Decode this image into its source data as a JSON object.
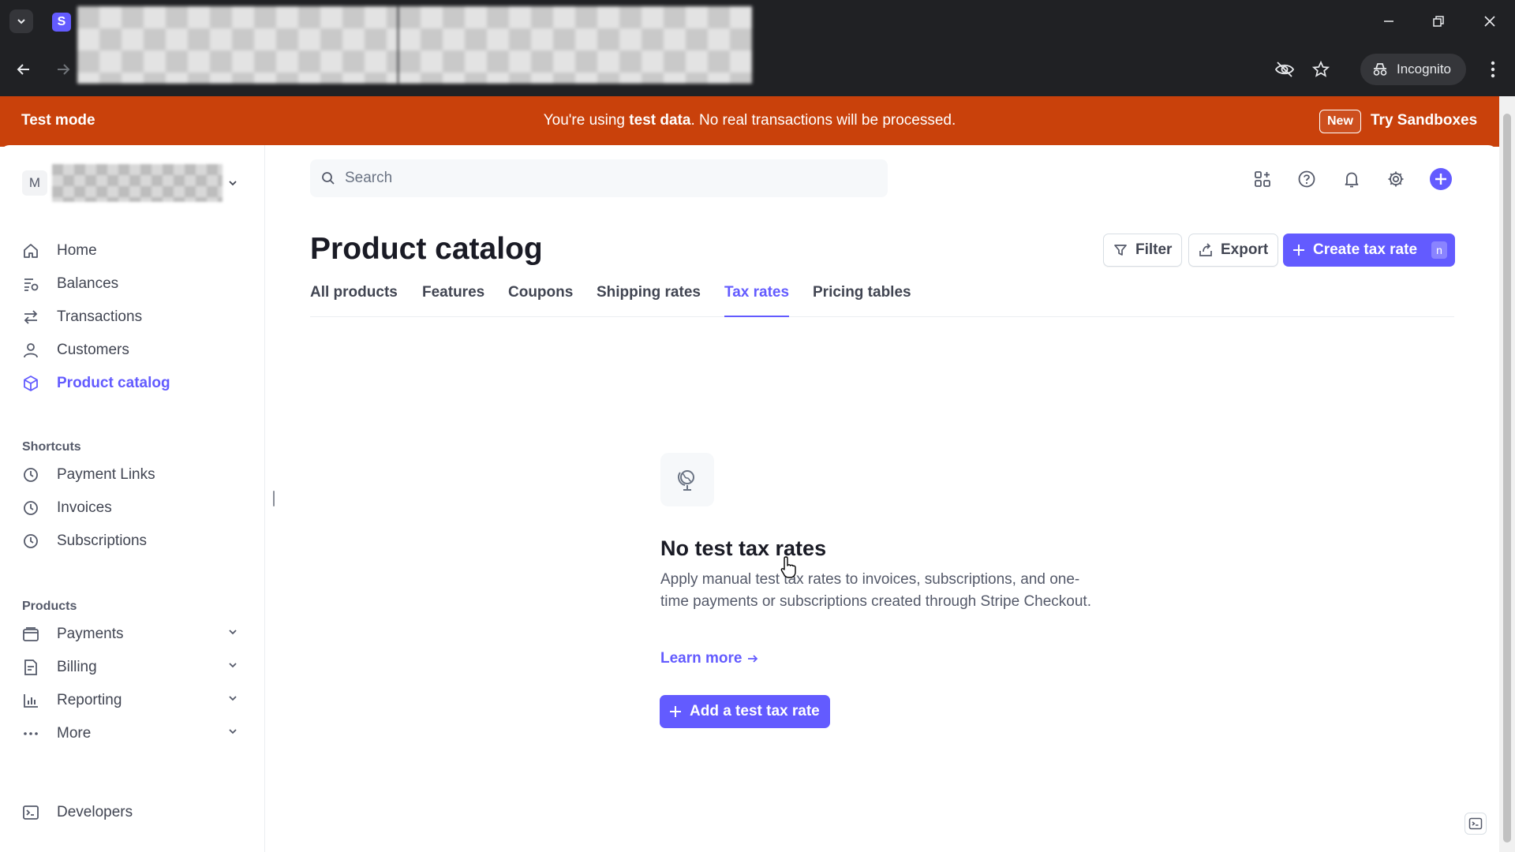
{
  "browser": {
    "favicon_letter": "S",
    "incognito_label": "Incognito"
  },
  "banner": {
    "mode_label": "Test mode",
    "message_prefix": "You're using ",
    "message_bold": "test data",
    "message_suffix": ". No real transactions will be processed.",
    "new_badge": "New",
    "sandbox_link": "Try Sandboxes",
    "color": "#c9410b"
  },
  "account": {
    "initial": "M"
  },
  "sidebar": {
    "items": [
      {
        "label": "Home",
        "icon": "home-icon"
      },
      {
        "label": "Balances",
        "icon": "balances-icon"
      },
      {
        "label": "Transactions",
        "icon": "transactions-icon"
      },
      {
        "label": "Customers",
        "icon": "customers-icon"
      },
      {
        "label": "Product catalog",
        "icon": "product-catalog-icon",
        "active": true
      }
    ],
    "shortcuts_title": "Shortcuts",
    "shortcuts": [
      {
        "label": "Payment Links",
        "icon": "clock-icon"
      },
      {
        "label": "Invoices",
        "icon": "clock-icon"
      },
      {
        "label": "Subscriptions",
        "icon": "clock-icon"
      }
    ],
    "products_title": "Products",
    "products": [
      {
        "label": "Payments",
        "icon": "payments-icon"
      },
      {
        "label": "Billing",
        "icon": "billing-icon"
      },
      {
        "label": "Reporting",
        "icon": "reporting-icon"
      },
      {
        "label": "More",
        "icon": "more-icon"
      }
    ],
    "developers": {
      "label": "Developers",
      "icon": "terminal-icon"
    }
  },
  "search": {
    "placeholder": "Search"
  },
  "header": {
    "title": "Product catalog",
    "filter_label": "Filter",
    "export_label": "Export",
    "create_label": "Create tax rate",
    "create_shortcut": "n"
  },
  "tabs": [
    {
      "label": "All products"
    },
    {
      "label": "Features"
    },
    {
      "label": "Coupons"
    },
    {
      "label": "Shipping rates"
    },
    {
      "label": "Tax rates",
      "active": true
    },
    {
      "label": "Pricing tables"
    }
  ],
  "empty_state": {
    "icon": "globe-icon",
    "title": "No test tax rates",
    "description": "Apply manual test tax rates to invoices, subscriptions, and one-time payments or subscriptions created through Stripe Checkout.",
    "learn_more": "Learn more",
    "add_button": "Add a test tax rate"
  },
  "colors": {
    "accent": "#635bff",
    "text": "#414552"
  }
}
